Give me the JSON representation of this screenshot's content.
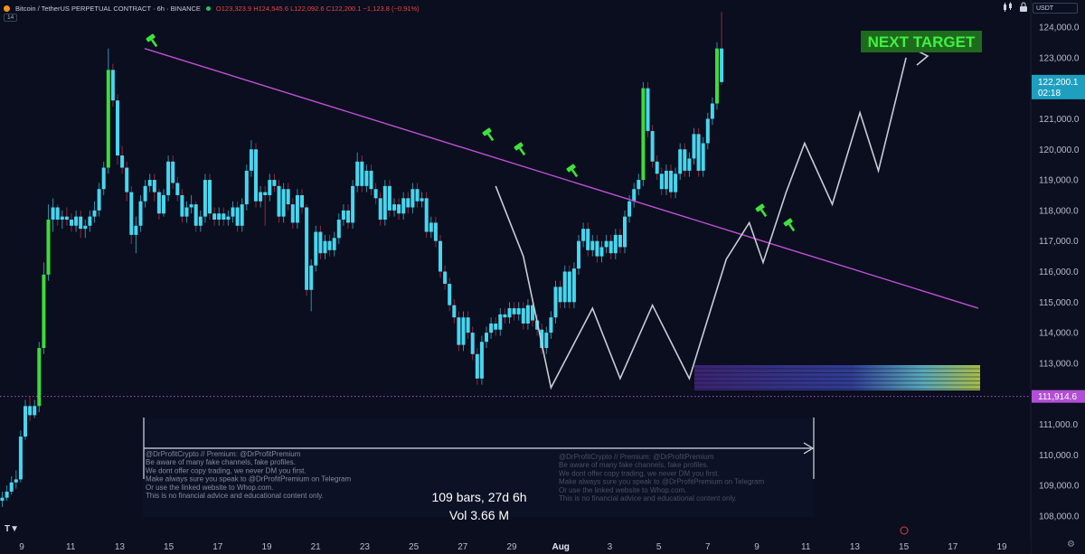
{
  "header": {
    "symbol": "Bitcoin / TetherUS PERPETUAL CONTRACT · 6h · BINANCE",
    "ohlc": "O123,323.9 H124,545.6 L122,092.6 C122,200.1 −1,123.8 (−0.91%)",
    "badge": "14",
    "currency": "USDT"
  },
  "chart_data": {
    "type": "candlestick",
    "interval": "6h",
    "price_axis": {
      "ylim": [
        107500,
        124700
      ],
      "ticks": [
        108000,
        109000,
        110000,
        111000,
        112000,
        113000,
        114000,
        115000,
        116000,
        117000,
        118000,
        119000,
        120000,
        121000,
        122000,
        123000,
        124000
      ],
      "tick_labels": [
        "108,000.0",
        "109,000.0",
        "110,000.0",
        "111,000.0",
        "112,000.0",
        "113,000.0",
        "114,000.0",
        "115,000.0",
        "116,000.0",
        "117,000.0",
        "118,000.0",
        "119,000.0",
        "120,000.0",
        "121,000.0",
        "122,000.0",
        "123,000.0",
        "124,000.0"
      ]
    },
    "time_axis": {
      "labels": [
        "9",
        "11",
        "13",
        "15",
        "17",
        "19",
        "21",
        "23",
        "25",
        "27",
        "29",
        "Aug",
        "3",
        "5",
        "7",
        "9",
        "11",
        "13",
        "15",
        "17",
        "19"
      ]
    },
    "current_price": {
      "value": 122200.1,
      "label": "122,200.1",
      "countdown": "02:18"
    },
    "support_level": {
      "value": 111914.6,
      "label": "111,914.6"
    },
    "trendline": {
      "start": {
        "day": "14",
        "price": 123300
      },
      "end": {
        "day": "17",
        "price": 114800
      }
    },
    "annotations": {
      "target_label": "NEXT TARGET",
      "range_stats": [
        "109 bars, 27d 6h",
        "Vol 3.66 M"
      ],
      "watermark": [
        "@DrProfitCrypto // Premium: @DrProfitPremium",
        "Be aware of many fake channels, fake profiles.",
        "We dont offer copy trading, we never DM you first.",
        "Make always sure you speak to @DrProfitPremium on Telegram",
        "Or use the linked website to Whop.com.",
        "This is no financial advice and educational content only."
      ]
    },
    "candles": [
      [
        108500,
        108600,
        108300,
        108800
      ],
      [
        108600,
        108800,
        108500,
        109000
      ],
      [
        108800,
        109100,
        108700,
        109300
      ],
      [
        109100,
        109200,
        108900,
        109500
      ],
      [
        109200,
        110600,
        109100,
        110800
      ],
      [
        110600,
        111600,
        110500,
        111800
      ],
      [
        111600,
        111300,
        111100,
        111900
      ],
      [
        111300,
        111600,
        111200,
        111800
      ],
      [
        111600,
        113500,
        111400,
        113700
      ],
      [
        113500,
        115900,
        113300,
        116300
      ],
      [
        115900,
        117700,
        115700,
        118200
      ],
      [
        117700,
        118100,
        117300,
        118400
      ],
      [
        118100,
        117700,
        117500,
        118200
      ],
      [
        117700,
        117800,
        117400,
        118000
      ],
      [
        117800,
        117700,
        117500,
        118100
      ],
      [
        117700,
        117500,
        117300,
        117900
      ],
      [
        117500,
        117800,
        117300,
        118000
      ],
      [
        117800,
        117400,
        117100,
        118000
      ],
      [
        117400,
        117500,
        117100,
        117700
      ],
      [
        117500,
        117800,
        117300,
        118000
      ],
      [
        117800,
        118000,
        117600,
        118300
      ],
      [
        118000,
        118700,
        117800,
        118900
      ],
      [
        118700,
        119400,
        118500,
        119600
      ],
      [
        119400,
        122600,
        119200,
        123300
      ],
      [
        122600,
        121600,
        121400,
        122800
      ],
      [
        121600,
        119800,
        119500,
        121800
      ],
      [
        119800,
        119400,
        119200,
        120100
      ],
      [
        119400,
        118600,
        118300,
        119600
      ],
      [
        118600,
        117200,
        116900,
        118800
      ],
      [
        117200,
        117500,
        116600,
        117800
      ],
      [
        117500,
        118300,
        117300,
        118500
      ],
      [
        118300,
        118800,
        118100,
        119000
      ],
      [
        118800,
        119000,
        118600,
        119200
      ],
      [
        119000,
        118600,
        118300,
        119200
      ],
      [
        118600,
        117900,
        117700,
        118700
      ],
      [
        117900,
        118500,
        117800,
        118700
      ],
      [
        118500,
        119600,
        118300,
        119800
      ],
      [
        119600,
        118900,
        118700,
        119800
      ],
      [
        118900,
        118500,
        118300,
        119100
      ],
      [
        118500,
        117800,
        117600,
        118700
      ],
      [
        117800,
        118100,
        117600,
        118300
      ],
      [
        118100,
        118200,
        117900,
        118500
      ],
      [
        118200,
        117500,
        117300,
        118300
      ],
      [
        117500,
        117800,
        117300,
        118000
      ],
      [
        117800,
        119000,
        117600,
        119200
      ],
      [
        119000,
        117900,
        117700,
        119200
      ],
      [
        117900,
        117700,
        117500,
        118100
      ],
      [
        117700,
        117900,
        117500,
        118100
      ],
      [
        117900,
        117700,
        117500,
        118100
      ],
      [
        117700,
        117800,
        117500,
        118000
      ],
      [
        117800,
        118100,
        117600,
        118300
      ],
      [
        118100,
        117500,
        117300,
        118300
      ],
      [
        117500,
        118200,
        117300,
        118400
      ],
      [
        118200,
        119300,
        118000,
        119500
      ],
      [
        119300,
        120000,
        119100,
        120300
      ],
      [
        120000,
        118300,
        118100,
        120200
      ],
      [
        118300,
        118600,
        118100,
        118800
      ],
      [
        118600,
        118500,
        117500,
        118800
      ],
      [
        118500,
        119000,
        118300,
        119200
      ],
      [
        119000,
        118800,
        118600,
        119200
      ],
      [
        118800,
        117800,
        117600,
        119000
      ],
      [
        117800,
        118700,
        117600,
        118900
      ],
      [
        118700,
        118200,
        118000,
        118900
      ],
      [
        118200,
        117600,
        117400,
        118400
      ],
      [
        117600,
        118500,
        117400,
        118700
      ],
      [
        118500,
        118100,
        117900,
        118700
      ],
      [
        118100,
        115400,
        115200,
        118200
      ],
      [
        115400,
        116200,
        114700,
        116400
      ],
      [
        116200,
        117300,
        116000,
        117500
      ],
      [
        117300,
        116600,
        116400,
        117500
      ],
      [
        116600,
        117000,
        116400,
        117200
      ],
      [
        117000,
        116700,
        116500,
        117200
      ],
      [
        116700,
        117100,
        116500,
        117300
      ],
      [
        117100,
        117700,
        116900,
        117900
      ],
      [
        117700,
        118000,
        117500,
        118200
      ],
      [
        118000,
        117600,
        117400,
        118200
      ],
      [
        117600,
        118800,
        117400,
        119000
      ],
      [
        118800,
        119600,
        118600,
        119900
      ],
      [
        119600,
        118800,
        118600,
        119800
      ],
      [
        118800,
        119300,
        118600,
        119500
      ],
      [
        119300,
        118700,
        118500,
        119500
      ],
      [
        118700,
        118400,
        118200,
        118900
      ],
      [
        118400,
        117700,
        117500,
        118600
      ],
      [
        117700,
        118800,
        117500,
        119000
      ],
      [
        118800,
        118000,
        117800,
        119000
      ],
      [
        118000,
        118200,
        117800,
        118400
      ],
      [
        118200,
        117900,
        117700,
        118400
      ],
      [
        117900,
        118400,
        117700,
        118600
      ],
      [
        118400,
        118100,
        117900,
        118600
      ],
      [
        118100,
        118700,
        117900,
        118900
      ],
      [
        118700,
        118300,
        118100,
        118900
      ],
      [
        118300,
        118400,
        118100,
        118600
      ],
      [
        118400,
        117300,
        117100,
        118600
      ],
      [
        117300,
        117600,
        117100,
        117800
      ],
      [
        117600,
        117000,
        116800,
        117800
      ],
      [
        117000,
        116000,
        115800,
        117200
      ],
      [
        116000,
        115600,
        115400,
        116200
      ],
      [
        115600,
        114900,
        114700,
        115800
      ],
      [
        114900,
        114500,
        114300,
        115100
      ],
      [
        114500,
        113600,
        113400,
        114700
      ],
      [
        113600,
        114500,
        113400,
        114700
      ],
      [
        114500,
        114000,
        113800,
        114700
      ],
      [
        114000,
        113300,
        113100,
        114200
      ],
      [
        113300,
        112500,
        112300,
        113500
      ],
      [
        112500,
        113700,
        112300,
        113900
      ],
      [
        113700,
        114000,
        113500,
        114200
      ],
      [
        114000,
        114300,
        113800,
        114500
      ],
      [
        114300,
        114100,
        113900,
        114500
      ],
      [
        114100,
        114600,
        113900,
        114800
      ],
      [
        114600,
        114500,
        114300,
        114800
      ],
      [
        114500,
        114800,
        114300,
        115000
      ],
      [
        114800,
        114600,
        114400,
        115000
      ],
      [
        114600,
        114800,
        114400,
        115000
      ],
      [
        114800,
        114300,
        114100,
        115000
      ],
      [
        114300,
        114900,
        114100,
        115100
      ],
      [
        114900,
        114400,
        114200,
        115100
      ],
      [
        114400,
        114100,
        113900,
        114600
      ],
      [
        114100,
        113500,
        113300,
        114300
      ],
      [
        113500,
        114000,
        113300,
        114200
      ],
      [
        114000,
        114500,
        113800,
        114700
      ],
      [
        114500,
        115500,
        114300,
        115700
      ],
      [
        115500,
        115000,
        114800,
        115700
      ],
      [
        115000,
        116000,
        114800,
        116200
      ],
      [
        116000,
        115000,
        114800,
        116200
      ],
      [
        115000,
        116100,
        114800,
        116300
      ],
      [
        116100,
        117000,
        115900,
        117200
      ],
      [
        117000,
        117400,
        116800,
        117600
      ],
      [
        117400,
        116700,
        116500,
        117600
      ],
      [
        116700,
        117000,
        116500,
        117200
      ],
      [
        117000,
        116500,
        116300,
        117200
      ],
      [
        116500,
        116800,
        116300,
        117000
      ],
      [
        116800,
        117000,
        116600,
        117200
      ],
      [
        117000,
        116600,
        116400,
        117200
      ],
      [
        116600,
        117200,
        116400,
        117400
      ],
      [
        117200,
        116800,
        116600,
        117400
      ],
      [
        116800,
        117800,
        116600,
        118000
      ],
      [
        117800,
        118300,
        117600,
        118500
      ],
      [
        118300,
        118700,
        118100,
        118900
      ],
      [
        118700,
        119000,
        118500,
        119200
      ],
      [
        119000,
        122000,
        118800,
        122200
      ],
      [
        122000,
        120600,
        120400,
        122200
      ],
      [
        120600,
        119600,
        119400,
        120800
      ],
      [
        119600,
        119200,
        119000,
        119800
      ],
      [
        119200,
        118700,
        118500,
        119400
      ],
      [
        118700,
        119300,
        118500,
        119500
      ],
      [
        119300,
        118600,
        118400,
        119500
      ],
      [
        118600,
        119200,
        118400,
        119400
      ],
      [
        119200,
        120000,
        119000,
        120200
      ],
      [
        120000,
        119300,
        119100,
        120200
      ],
      [
        119300,
        119700,
        119100,
        119900
      ],
      [
        119700,
        120500,
        119500,
        120700
      ],
      [
        120500,
        119300,
        119100,
        120700
      ],
      [
        119300,
        120200,
        119100,
        120400
      ],
      [
        120200,
        121000,
        120000,
        121200
      ],
      [
        121000,
        121500,
        120800,
        121700
      ],
      [
        121500,
        123300,
        121300,
        123500
      ],
      [
        123300,
        122200,
        122100,
        124500
      ]
    ],
    "zigzag_path": [
      {
        "bar": 107,
        "price": 118800
      },
      {
        "bar": 113,
        "price": 116500
      },
      {
        "bar": 119,
        "price": 112200
      },
      {
        "bar": 128,
        "price": 114800
      },
      {
        "bar": 134,
        "price": 112500
      },
      {
        "bar": 141,
        "price": 114900
      },
      {
        "bar": 149,
        "price": 112500
      },
      {
        "bar": 157,
        "price": 116400
      },
      {
        "bar": 162,
        "price": 117600
      },
      {
        "bar": 165,
        "price": 116300
      },
      {
        "bar": 170,
        "price": 118600
      },
      {
        "bar": 174,
        "price": 120200
      },
      {
        "bar": 180,
        "price": 118200
      },
      {
        "bar": 186,
        "price": 121200
      },
      {
        "bar": 190,
        "price": 119300
      },
      {
        "bar": 196,
        "price": 123000
      }
    ]
  }
}
